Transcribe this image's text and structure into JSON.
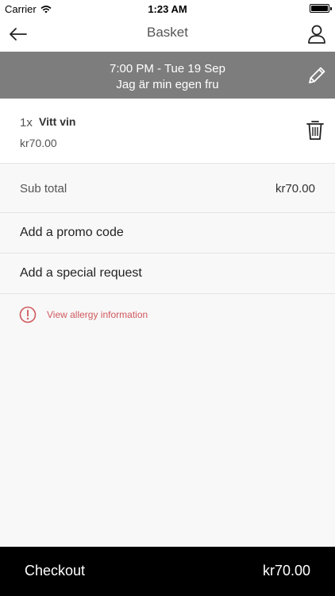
{
  "status_bar": {
    "carrier": "Carrier",
    "time": "1:23 AM"
  },
  "nav": {
    "title": "Basket",
    "back_icon": "arrow-left-icon",
    "profile_icon": "user-icon"
  },
  "banner": {
    "datetime": "7:00 PM - Tue 19 Sep",
    "venue": "Jag är min egen fru",
    "edit_icon": "pencil-icon"
  },
  "basket": {
    "items": [
      {
        "qty": "1x",
        "name": "Vitt vin",
        "price": "kr70.00"
      }
    ]
  },
  "subtotal": {
    "label": "Sub total",
    "value": "kr70.00"
  },
  "promo": {
    "label": "Add a promo code"
  },
  "special_request": {
    "label": "Add a special request"
  },
  "allergy": {
    "label": "View allergy information"
  },
  "checkout": {
    "label": "Checkout",
    "total": "kr70.00"
  },
  "colors": {
    "banner": "#7d7d7d",
    "allergy": "#d0585d",
    "checkout_bg": "#000000"
  }
}
